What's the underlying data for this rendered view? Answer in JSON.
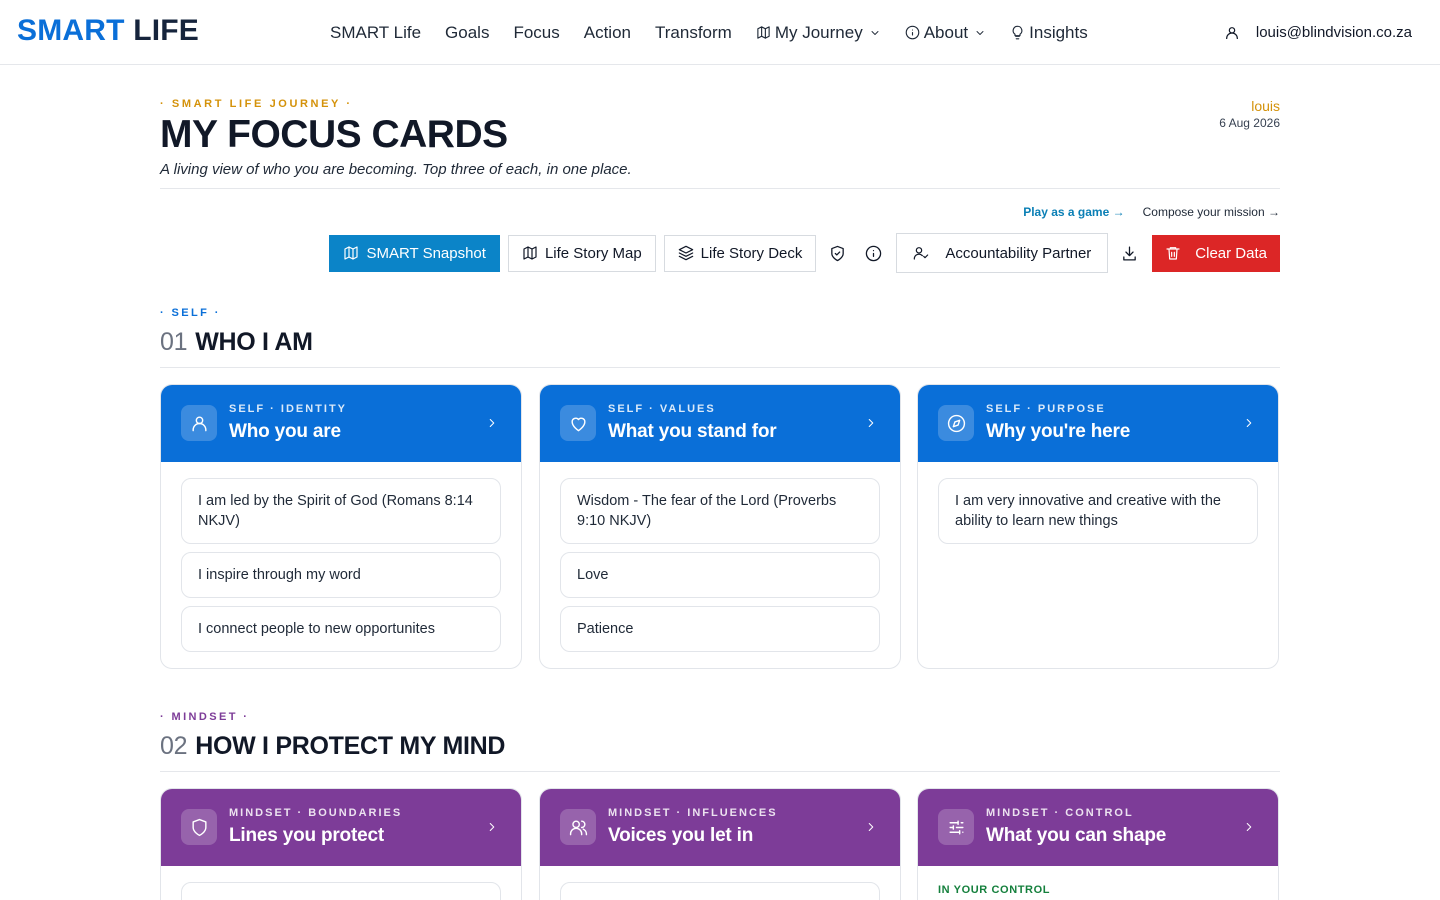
{
  "brand": {
    "part1": "SMART",
    "part2": "LIFE"
  },
  "nav": {
    "smart_life": "SMART Life",
    "goals": "Goals",
    "focus": "Focus",
    "action": "Action",
    "transform": "Transform",
    "my_journey": "My Journey",
    "about": "About",
    "insights": "Insights"
  },
  "user": {
    "email": "louis@blindvision.co.za"
  },
  "header": {
    "eyebrow": "· SMART LIFE JOURNEY ·",
    "title": "MY FOCUS CARDS",
    "subtitle": "A living view of who you are becoming. Top three of each, in one place.",
    "name": "louis",
    "date": "6 Aug 2026"
  },
  "links": {
    "play": "Play as a game →",
    "compose": "Compose your mission →"
  },
  "toolbar": {
    "snapshot": "SMART Snapshot",
    "story_map": "Life Story Map",
    "story_deck": "Life Story Deck",
    "partner": "Accountability Partner",
    "clear": "Clear Data"
  },
  "colors": {
    "blue": "#0a6fd8",
    "purple": "#7d3c98",
    "gold": "#d4920a",
    "danger": "#dc2626",
    "primary": "#0b84c8"
  },
  "sections": [
    {
      "eyebrow": "· SELF ·",
      "num": "01",
      "title": "WHO I AM",
      "cards": [
        {
          "eyebrow": "SELF · IDENTITY",
          "title": "Who you are",
          "icon": "user-icon",
          "items": [
            "I am led by the Spirit of God (Romans 8:14 NKJV)",
            "I inspire through my word",
            "I connect people to new opportunites"
          ]
        },
        {
          "eyebrow": "SELF · VALUES",
          "title": "What you stand for",
          "icon": "heart-icon",
          "items": [
            "Wisdom - The fear of the Lord (Proverbs 9:10 NKJV)",
            "Love",
            "Patience"
          ]
        },
        {
          "eyebrow": "SELF · PURPOSE",
          "title": "Why you're here",
          "icon": "compass-icon",
          "items": [
            "I am very innovative and creative with the ability to learn new things"
          ]
        }
      ]
    },
    {
      "eyebrow": "· MINDSET ·",
      "num": "02",
      "title": "HOW I PROTECT MY MIND",
      "cards": [
        {
          "eyebrow": "MINDSET · BOUNDARIES",
          "title": "Lines you protect",
          "icon": "shield-icon",
          "items": []
        },
        {
          "eyebrow": "MINDSET · INFLUENCES",
          "title": "Voices you let in",
          "icon": "users-icon",
          "items": []
        },
        {
          "eyebrow": "MINDSET · CONTROL",
          "title": "What you can shape",
          "icon": "sliders-icon",
          "label": "IN YOUR CONTROL",
          "items": []
        }
      ]
    }
  ]
}
